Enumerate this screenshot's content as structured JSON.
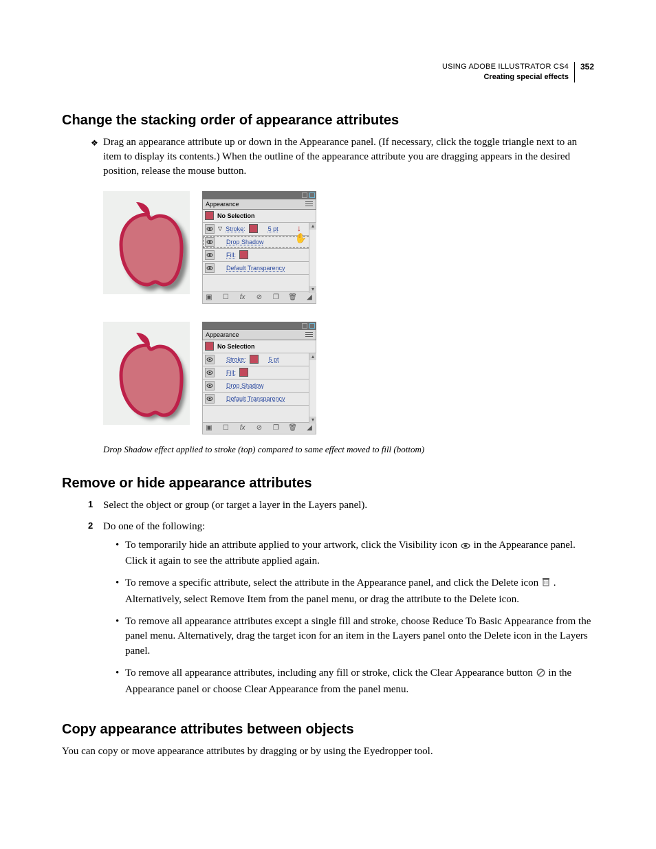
{
  "runningHead": {
    "title": "USING ADOBE ILLUSTRATOR CS4",
    "subtitle": "Creating special effects",
    "page": "352"
  },
  "section1": {
    "heading": "Change the stacking order of appearance attributes",
    "para": "Drag an appearance attribute up or down in the Appearance panel. (If necessary, click the toggle triangle next to an item to display its contents.) When the outline of the appearance attribute you are dragging appears in the desired position, release the mouse button."
  },
  "figure": {
    "caption": "Drop Shadow effect applied to stroke (top) compared to same effect moved to fill (bottom)",
    "panel": {
      "title": "Appearance",
      "noSelection": "No Selection",
      "strokeLbl": "Stroke:",
      "strokeVal": "5 pt",
      "dropShadow": "Drop Shadow",
      "fillLbl": "Fill:",
      "defaultTransparency": "Default Transparency",
      "fx": "fx"
    }
  },
  "section2": {
    "heading": "Remove or hide appearance attributes",
    "step1": "Select the object or group (or target a layer in the Layers panel).",
    "step2Intro": "Do one of the following:",
    "b1a": "To temporarily hide an attribute applied to your artwork, click the Visibility icon ",
    "b1b": " in the Appearance panel. Click it again to see the attribute applied again.",
    "b2a": "To remove a specific attribute, select the attribute in the Appearance panel, and click the Delete icon ",
    "b2b": " . Alternatively, select Remove Item from the panel menu, or drag the attribute to the Delete icon.",
    "b3": "To remove all appearance attributes except a single fill and stroke, choose Reduce To Basic Appearance from the panel menu. Alternatively, drag the target icon for an item in the Layers panel onto the Delete icon in the Layers panel.",
    "b4a": "To remove all appearance attributes, including any fill or stroke, click the Clear Appearance button ",
    "b4b": " in the Appearance panel or choose Clear Appearance from the panel menu."
  },
  "section3": {
    "heading": "Copy appearance attributes between objects",
    "para": "You can copy or move appearance attributes by dragging or by using the Eyedropper tool."
  }
}
